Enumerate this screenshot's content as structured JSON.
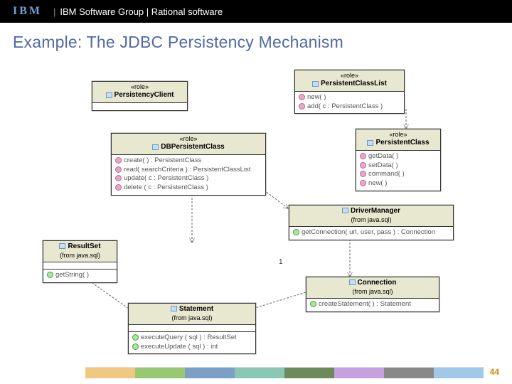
{
  "header": {
    "logo": "IBM",
    "text": "IBM Software Group | Rational software"
  },
  "title": "Example: The JDBC Persistency Mechanism",
  "classes": {
    "persistencyClient": {
      "stereotype": "«role»",
      "name": "PersistencyClient"
    },
    "persistentClassList": {
      "stereotype": "«role»",
      "name": "PersistentClassList",
      "ops": [
        "new( )",
        "add( c : PersistentClass )"
      ]
    },
    "dbPersistentClass": {
      "stereotype": "«role»",
      "name": "DBPersistentClass",
      "ops": [
        "create( ) : PersistentClass",
        "read( searchCriteria ) : PersistentClassList",
        "update( c : PersistentClass )",
        "delete ( c : PersistentClass )"
      ]
    },
    "persistentClass": {
      "stereotype": "«role»",
      "name": "PersistentClass",
      "ops": [
        "getData( )",
        "setData( )",
        "command( )",
        "new( )"
      ]
    },
    "driverManager": {
      "name": "DriverManager",
      "subtext": "(from java.sql)",
      "ops": [
        "getConnection( url, user, pass ) : Connection"
      ]
    },
    "resultSet": {
      "name": "ResultSet",
      "subtext": "(from java.sql)",
      "ops": [
        "getString( )"
      ]
    },
    "connection": {
      "name": "Connection",
      "subtext": "(from java.sql)",
      "ops": [
        "createStatement( ) : Statement"
      ]
    },
    "statement": {
      "name": "Statement",
      "subtext": "(from java.sql)",
      "ops": [
        "executeQuery ( sql ) : ResultSet",
        "executeUpdate ( sql ) : int"
      ]
    }
  },
  "multiplicity": "1",
  "pageNumber": "44"
}
